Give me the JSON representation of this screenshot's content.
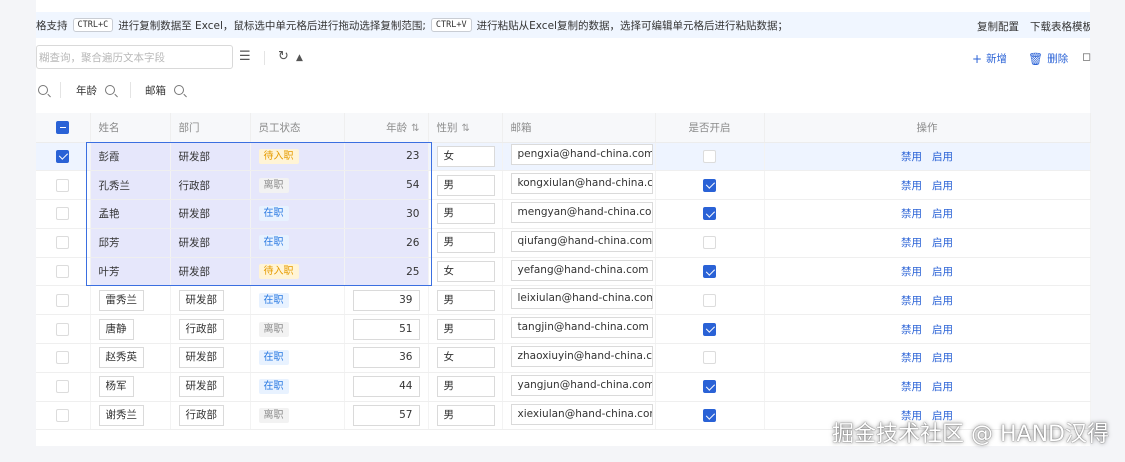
{
  "tipbar": {
    "prefix": "格支持",
    "kbd_copy": "CTRL+C",
    "mid": "进行复制数据至 Excel，鼠标选中单元格后进行拖动选择复制范围;",
    "kbd_paste": "CTRL+V",
    "suffix": "进行粘贴从Excel复制的数据，选择可编辑单元格后进行粘贴数据；",
    "link_config": "复制配置",
    "link_download": "下载表格模板"
  },
  "toolbar": {
    "search_placeholder": "糊查询，聚合遍历文本字段",
    "add_label": "新增",
    "delete_label": "删除"
  },
  "filters": {
    "age": "年龄",
    "email": "邮箱"
  },
  "columns": {
    "name": "姓名",
    "dept": "部门",
    "status": "员工状态",
    "age": "年龄",
    "gender": "性别",
    "email": "邮箱",
    "enabled": "是否开启",
    "action": "操作"
  },
  "actions": {
    "disable": "禁用",
    "enable": "启用"
  },
  "rows": [
    {
      "name": "彭霞",
      "dept": "研发部",
      "status": "待入职",
      "status_type": "pending",
      "age": "23",
      "gender": "女",
      "email": "pengxia@hand-china.com",
      "enabled": false,
      "row_checked": true
    },
    {
      "name": "孔秀兰",
      "dept": "行政部",
      "status": "离职",
      "status_type": "left",
      "age": "54",
      "gender": "男",
      "email": "kongxiulan@hand-china.com",
      "enabled": true,
      "row_checked": false
    },
    {
      "name": "孟艳",
      "dept": "研发部",
      "status": "在职",
      "status_type": "active",
      "age": "30",
      "gender": "男",
      "email": "mengyan@hand-china.com",
      "enabled": true,
      "row_checked": false
    },
    {
      "name": "邱芳",
      "dept": "研发部",
      "status": "在职",
      "status_type": "active",
      "age": "26",
      "gender": "男",
      "email": "qiufang@hand-china.com",
      "enabled": false,
      "row_checked": false
    },
    {
      "name": "叶芳",
      "dept": "研发部",
      "status": "待入职",
      "status_type": "pending",
      "age": "25",
      "gender": "女",
      "email": "yefang@hand-china.com",
      "enabled": true,
      "row_checked": false
    },
    {
      "name": "雷秀兰",
      "dept": "研发部",
      "status": "在职",
      "status_type": "active",
      "age": "39",
      "gender": "男",
      "email": "leixiulan@hand-china.com",
      "enabled": false,
      "row_checked": false
    },
    {
      "name": "唐静",
      "dept": "行政部",
      "status": "离职",
      "status_type": "left",
      "age": "51",
      "gender": "男",
      "email": "tangjin@hand-china.com",
      "enabled": true,
      "row_checked": false
    },
    {
      "name": "赵秀英",
      "dept": "研发部",
      "status": "在职",
      "status_type": "active",
      "age": "36",
      "gender": "女",
      "email": "zhaoxiuyin@hand-china.com",
      "enabled": false,
      "row_checked": false
    },
    {
      "name": "杨军",
      "dept": "研发部",
      "status": "在职",
      "status_type": "active",
      "age": "44",
      "gender": "男",
      "email": "yangjun@hand-china.com",
      "enabled": true,
      "row_checked": false
    },
    {
      "name": "谢秀兰",
      "dept": "行政部",
      "status": "离职",
      "status_type": "left",
      "age": "57",
      "gender": "男",
      "email": "xiexiulan@hand-china.com",
      "enabled": true,
      "row_checked": false
    }
  ],
  "watermark": "掘金技术社区 @ HAND汉得",
  "colors": {
    "accent": "#2a62d6",
    "pending": "#e69b00",
    "active": "#2a7ae2",
    "selection": "#3b6fe0"
  }
}
